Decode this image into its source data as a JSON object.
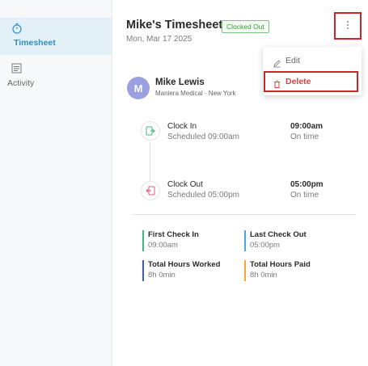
{
  "sidebar": {
    "items": [
      {
        "label": "Timesheet",
        "icon": "stopwatch-icon",
        "active": true
      },
      {
        "label": "Activity",
        "icon": "list-icon",
        "active": false
      }
    ]
  },
  "header": {
    "title": "Mike's Timesheet",
    "badge": "Clocked Out",
    "date": "Mon, Mar 17 2025",
    "more_icon": "kebab-menu-icon"
  },
  "menu": {
    "edit_label": "Edit",
    "delete_label": "Delete"
  },
  "user": {
    "initial": "M",
    "name": "Mike Lewis",
    "org": "Maniera Medical - New York"
  },
  "timeline": [
    {
      "title": "Clock In",
      "scheduled": "Scheduled 09:00am",
      "time": "09:00am",
      "status": "On time",
      "icon": "clock-in-icon"
    },
    {
      "title": "Clock Out",
      "scheduled": "Scheduled 05:00pm",
      "time": "05:00pm",
      "status": "On time",
      "icon": "clock-out-icon"
    }
  ],
  "stats": [
    {
      "label": "First Check In",
      "value": "09:00am",
      "color": "#3bb87a"
    },
    {
      "label": "Last Check Out",
      "value": "05:00pm",
      "color": "#4aa8e0"
    },
    {
      "label": "Total Hours Worked",
      "value": "8h 0min",
      "color": "#3b5fa8"
    },
    {
      "label": "Total Hours Paid",
      "value": "8h 0min",
      "color": "#f0a830"
    }
  ],
  "colors": {
    "accent": "#2f8fc4",
    "badge_green": "#3a9a3a",
    "delete_red": "#d94141",
    "highlight_red": "#d0242a",
    "avatar": "#9aa0e0"
  }
}
